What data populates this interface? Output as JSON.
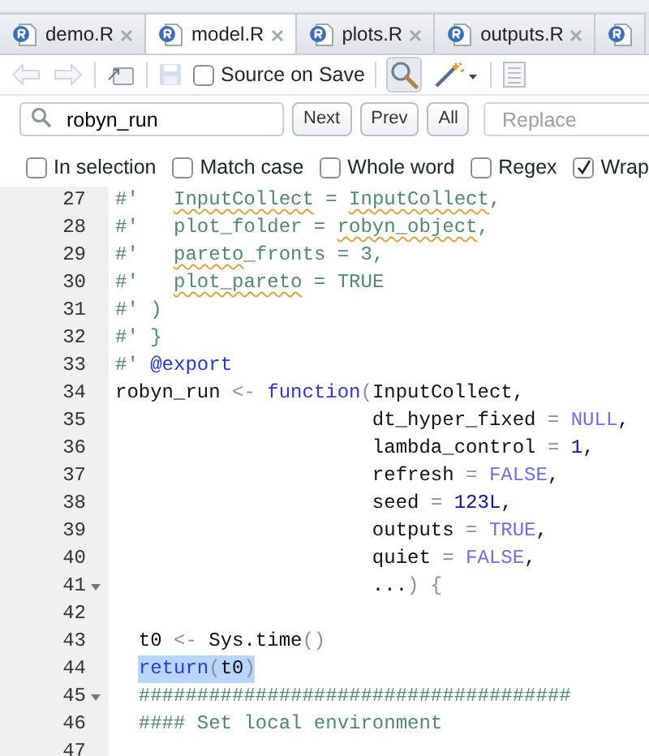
{
  "tabs": [
    {
      "label": "demo.R",
      "selected": false
    },
    {
      "label": "model.R",
      "selected": true
    },
    {
      "label": "plots.R",
      "selected": false
    },
    {
      "label": "outputs.R",
      "selected": false
    },
    {
      "selected": false
    }
  ],
  "toolbar": [
    {
      "kind": "back",
      "disabled": true
    },
    {
      "kind": "forward",
      "disabled": true
    },
    {
      "kind": "popout"
    },
    {
      "kind": "save",
      "disabled": true
    },
    {
      "kind": "checkbox",
      "label": "Source on Save",
      "checked": false
    },
    {
      "kind": "find",
      "pressed": true
    },
    {
      "kind": "wand"
    },
    {
      "kind": "outline"
    }
  ],
  "find_bar": {
    "query": "robyn_run",
    "buttons": [
      "Next",
      "Prev",
      "All"
    ],
    "replace_placeholder": "Replace"
  },
  "find_options": [
    {
      "label": "In selection",
      "checked": false
    },
    {
      "label": "Match case",
      "checked": false
    },
    {
      "label": "Whole word",
      "checked": false
    },
    {
      "label": "Regex",
      "checked": false
    },
    {
      "label": "Wrap",
      "checked": true
    }
  ],
  "editor": {
    "lines": [
      {
        "number": "27",
        "tokens": [
          {
            "text": "#'   ",
            "kind": "comment"
          },
          {
            "text": "InputCollect",
            "kind": "misspelled"
          },
          {
            "text": " = ",
            "kind": "comment"
          },
          {
            "text": "InputCollect",
            "kind": "misspelled"
          },
          {
            "text": ",",
            "kind": "comment"
          }
        ]
      },
      {
        "number": "28",
        "tokens": [
          {
            "text": "#'   plot_folder = ",
            "kind": "comment"
          },
          {
            "text": "robyn_object",
            "kind": "misspelled"
          },
          {
            "text": ",",
            "kind": "comment"
          }
        ]
      },
      {
        "number": "29",
        "tokens": [
          {
            "text": "#'   ",
            "kind": "comment"
          },
          {
            "text": "pareto",
            "kind": "misspelled"
          },
          {
            "text": "_fronts = 3,",
            "kind": "comment"
          }
        ]
      },
      {
        "number": "30",
        "tokens": [
          {
            "text": "#'   ",
            "kind": "comment"
          },
          {
            "text": "plot_pareto",
            "kind": "misspelled"
          },
          {
            "text": " = TRUE",
            "kind": "comment"
          }
        ]
      },
      {
        "number": "31",
        "tokens": [
          {
            "text": "#' )",
            "kind": "comment"
          }
        ]
      },
      {
        "number": "32",
        "tokens": [
          {
            "text": "#' }",
            "kind": "comment"
          }
        ]
      },
      {
        "number": "33",
        "tokens": [
          {
            "text": "#' ",
            "kind": "comment"
          },
          {
            "text": "@export",
            "kind": "tag"
          }
        ]
      },
      {
        "number": "34",
        "tokens": [
          {
            "text": "robyn_run ",
            "kind": "code"
          },
          {
            "text": "<- ",
            "kind": "op"
          },
          {
            "text": "function",
            "kind": "keyword"
          },
          {
            "text": "(",
            "kind": "paren"
          },
          {
            "text": "InputCollect,",
            "kind": "code"
          }
        ]
      },
      {
        "number": "35",
        "tokens": [
          {
            "text": "                      dt_hyper_fixed ",
            "kind": "code"
          },
          {
            "text": "= ",
            "kind": "op"
          },
          {
            "text": "NULL",
            "kind": "const"
          },
          {
            "text": ",",
            "kind": "code"
          }
        ]
      },
      {
        "number": "36",
        "tokens": [
          {
            "text": "                      lambda_control ",
            "kind": "code"
          },
          {
            "text": "= ",
            "kind": "op"
          },
          {
            "text": "1",
            "kind": "number"
          },
          {
            "text": ",",
            "kind": "code"
          }
        ]
      },
      {
        "number": "37",
        "tokens": [
          {
            "text": "                      refresh ",
            "kind": "code"
          },
          {
            "text": "= ",
            "kind": "op"
          },
          {
            "text": "FALSE",
            "kind": "const"
          },
          {
            "text": ",",
            "kind": "code"
          }
        ]
      },
      {
        "number": "38",
        "tokens": [
          {
            "text": "                      seed ",
            "kind": "code"
          },
          {
            "text": "= ",
            "kind": "op"
          },
          {
            "text": "123L",
            "kind": "number"
          },
          {
            "text": ",",
            "kind": "code"
          }
        ]
      },
      {
        "number": "39",
        "tokens": [
          {
            "text": "                      outputs ",
            "kind": "code"
          },
          {
            "text": "= ",
            "kind": "op"
          },
          {
            "text": "TRUE",
            "kind": "const"
          },
          {
            "text": ",",
            "kind": "code"
          }
        ]
      },
      {
        "number": "40",
        "tokens": [
          {
            "text": "                      quiet ",
            "kind": "code"
          },
          {
            "text": "= ",
            "kind": "op"
          },
          {
            "text": "FALSE",
            "kind": "const"
          },
          {
            "text": ",",
            "kind": "code"
          }
        ]
      },
      {
        "number": "41",
        "foldable": true,
        "tokens": [
          {
            "text": "                      ...",
            "kind": "code"
          },
          {
            "text": ") {",
            "kind": "paren"
          }
        ]
      },
      {
        "number": "42"
      },
      {
        "number": "43",
        "tokens": [
          {
            "text": "  t0 ",
            "kind": "code"
          },
          {
            "text": "<-",
            "kind": "op"
          },
          {
            "text": " Sys.time",
            "kind": "code"
          },
          {
            "text": "()",
            "kind": "paren"
          }
        ]
      },
      {
        "number": "44",
        "cursor": true,
        "tokens": [
          {
            "text": "  return",
            "kind": "keyword",
            "selected": true
          },
          {
            "text": "(",
            "kind": "paren",
            "selected": true
          },
          {
            "text": "t0",
            "kind": "code",
            "selected": true
          },
          {
            "text": ")",
            "kind": "paren",
            "selected": true
          }
        ]
      },
      {
        "number": "45",
        "foldable": true,
        "tokens": [
          {
            "text": "  #####################################",
            "kind": "comment"
          }
        ]
      },
      {
        "number": "46",
        "tokens": [
          {
            "text": "  #### Set local environment",
            "kind": "comment"
          }
        ]
      },
      {
        "number": "47"
      }
    ]
  }
}
